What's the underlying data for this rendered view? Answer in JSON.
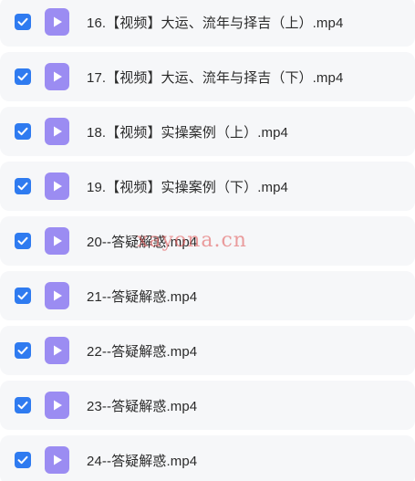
{
  "colors": {
    "checkbox": "#2f7bf0",
    "file_icon": "#9b8cf2",
    "row_background": "#f6f7f9",
    "watermark": "#e05050"
  },
  "files": [
    {
      "name": "16.【视频】大运、流年与择吉（上）.mp4",
      "checked": true,
      "icon": "video-file-icon"
    },
    {
      "name": "17.【视频】大运、流年与择吉（下）.mp4",
      "checked": true,
      "icon": "video-file-icon"
    },
    {
      "name": "18.【视频】实操案例（上）.mp4",
      "checked": true,
      "icon": "video-file-icon"
    },
    {
      "name": "19.【视频】实操案例（下）.mp4",
      "checked": true,
      "icon": "video-file-icon"
    },
    {
      "name": "20--答疑解惑.mp4",
      "checked": true,
      "icon": "video-file-icon"
    },
    {
      "name": "21--答疑解惑.mp4",
      "checked": true,
      "icon": "video-file-icon"
    },
    {
      "name": "22--答疑解惑.mp4",
      "checked": true,
      "icon": "video-file-icon"
    },
    {
      "name": "23--答疑解惑.mp4",
      "checked": true,
      "icon": "video-file-icon"
    },
    {
      "name": "24--答疑解惑.mp4",
      "checked": true,
      "icon": "video-file-icon"
    }
  ],
  "watermark": "xayona.cn"
}
